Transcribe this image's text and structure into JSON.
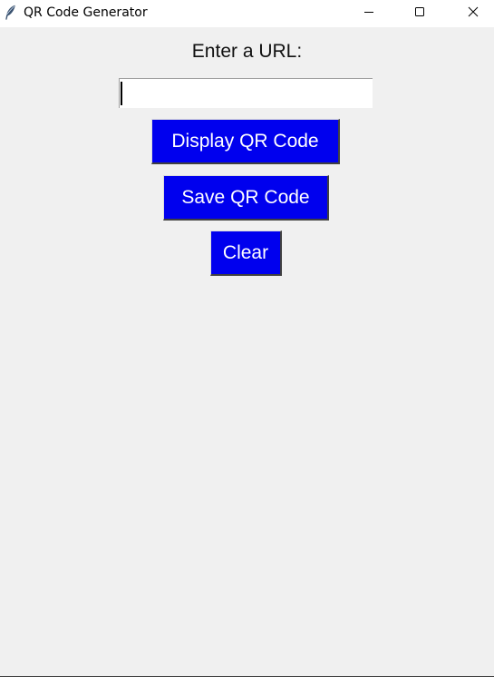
{
  "window": {
    "title": "QR Code Generator",
    "icon": "feather-icon"
  },
  "title_controls": {
    "minimize_icon": "minimize-icon",
    "maximize_icon": "maximize-icon",
    "close_icon": "close-icon"
  },
  "form": {
    "url_label": "Enter a URL:",
    "url_value": "",
    "url_placeholder": ""
  },
  "buttons": {
    "display_label": "Display QR Code",
    "save_label": "Save QR Code",
    "clear_label": "Clear"
  },
  "colors": {
    "button_bg": "#0000ee",
    "button_text": "#ffffff",
    "window_bg": "#f0f0f0"
  }
}
